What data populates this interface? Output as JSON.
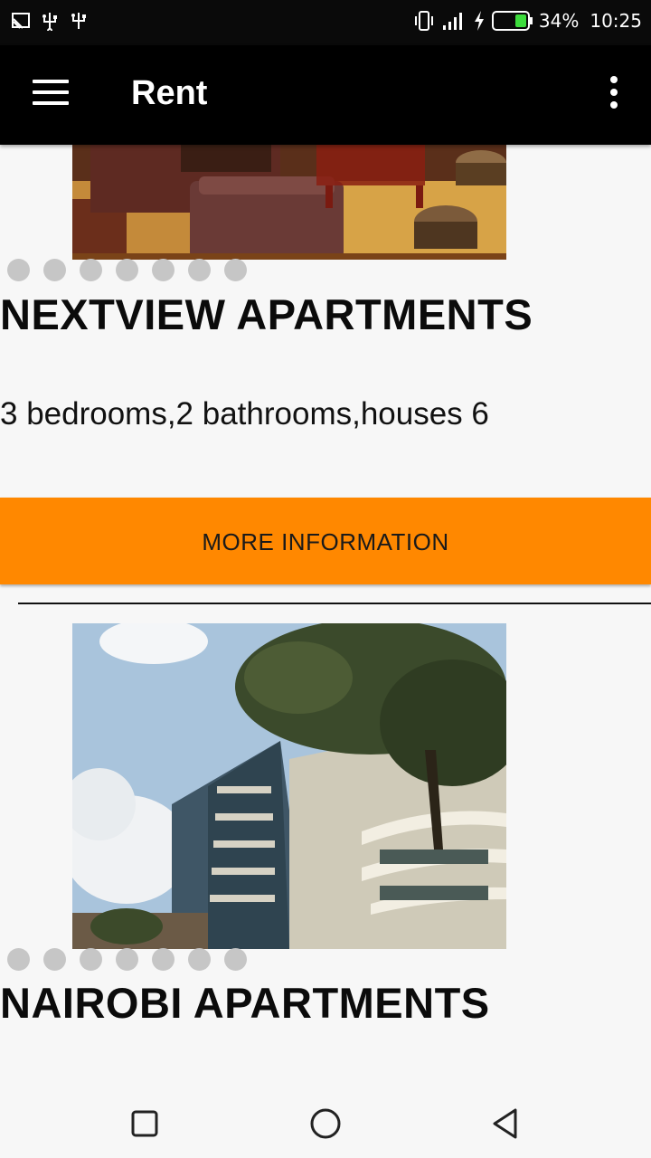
{
  "status_bar": {
    "battery": "34%",
    "time": "10:25"
  },
  "app_bar": {
    "title": "Rent"
  },
  "listings": [
    {
      "title": "NEXTVIEW APARTMENTS",
      "description": "3 bedrooms,2 bathrooms,houses 6",
      "button_label": "MORE INFORMATION",
      "image_count": 7
    },
    {
      "title": "NAIROBI APARTMENTS",
      "image_count": 7
    }
  ],
  "colors": {
    "accent": "#ff8800",
    "app_bar": "#000000",
    "background": "#f7f7f7"
  }
}
